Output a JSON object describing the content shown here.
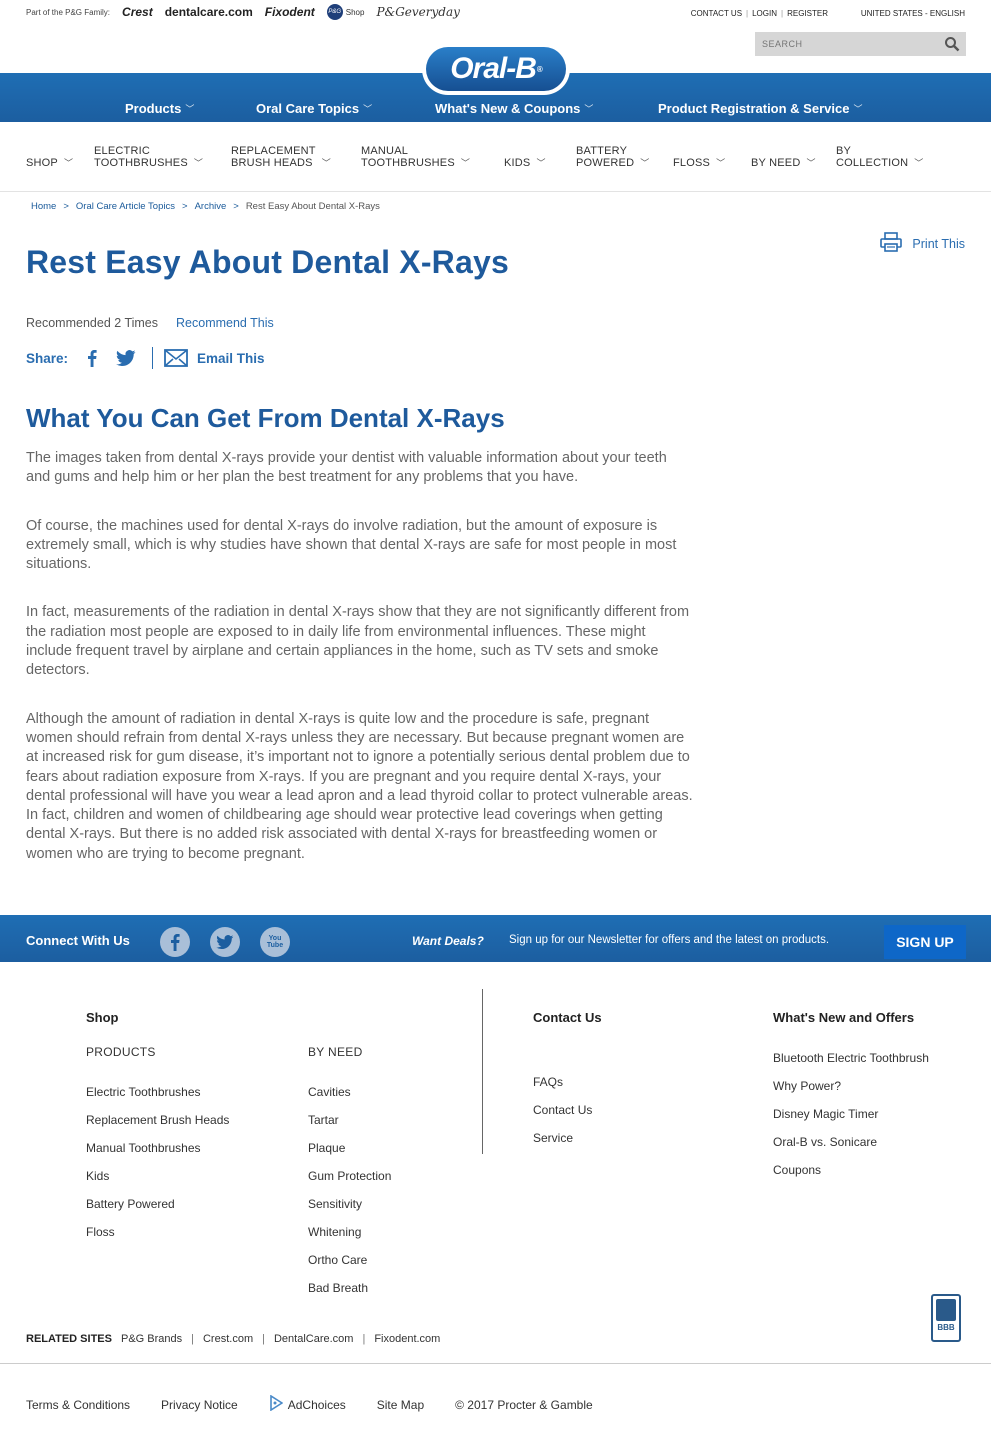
{
  "family": {
    "label": "Part of the P&G Family:",
    "brands": [
      "Crest",
      "dentalcare.com",
      "Fixodent",
      "Shop",
      "P&Geveryday"
    ],
    "pg_mark": "P&G"
  },
  "toplinks": {
    "contact": "CONTACT US",
    "login": "LOGIN",
    "register": "REGISTER",
    "region": "UNITED STATES - ENGLISH"
  },
  "search": {
    "placeholder": "SEARCH"
  },
  "logo": {
    "text": "Oral-B",
    "reg": "®"
  },
  "main_nav": [
    "Products",
    "Oral Care Topics",
    "What's New & Coupons",
    "Product Registration & Service"
  ],
  "sub_nav": [
    [
      "SHOP"
    ],
    [
      "ELECTRIC",
      "TOOTHBRUSHES"
    ],
    [
      "REPLACEMENT",
      "BRUSH HEADS"
    ],
    [
      "MANUAL",
      "TOOTHBRUSHES"
    ],
    [
      "KIDS"
    ],
    [
      "BATTERY",
      "POWERED"
    ],
    [
      "FLOSS"
    ],
    [
      "BY NEED"
    ],
    [
      "BY",
      "COLLECTION"
    ]
  ],
  "breadcrumb": [
    "Home",
    "Oral Care Article Topics",
    "Archive",
    "Rest Easy About Dental X-Rays"
  ],
  "print_label": "Print This",
  "title": "Rest Easy About Dental X-Rays",
  "recommend": {
    "count_text": "Recommended 2 Times",
    "link": "Recommend This"
  },
  "share": {
    "label": "Share:",
    "email": "Email This"
  },
  "subtitle": "What You Can Get From Dental X-Rays",
  "paragraphs": [
    "The images taken from dental X-rays provide your dentist with valuable information about your teeth and gums and help him or her plan the best treatment for any problems that you have.",
    "Of course, the machines used for dental X-rays do involve radiation, but the amount of exposure is extremely small, which is why studies have shown that dental X-rays are safe for most people in most situations.",
    "In fact, measurements of the radiation in dental X-rays show that they are not significantly different from the radiation most people are exposed to in daily life from environmental influences. These might include frequent travel by airplane and certain appliances in the home, such as TV sets and smoke detectors.",
    "Although the amount of radiation in dental X-rays is quite low and the procedure is safe, pregnant women should refrain from dental X-rays unless they are necessary. But because pregnant women are at increased risk for gum disease, it’s important not to ignore a potentially serious dental problem due to fears about radiation exposure from X-rays. If you are pregnant and you require dental X-rays, your dental professional will have you wear a lead apron and a lead thyroid collar to protect vulnerable areas. In fact, children and women of childbearing age should wear protective lead coverings when getting dental X-rays. But there is no added risk associated with dental X-rays for breastfeeding women or women who are trying to become pregnant."
  ],
  "connect": {
    "label": "Connect With Us",
    "youtube_text": "You Tube",
    "deals": "Want Deals?",
    "newsletter": "Sign up for our Newsletter for offers and the latest on products.",
    "signup": "SIGN UP"
  },
  "footer": {
    "shop_title": "Shop",
    "products_label": "PRODUCTS",
    "products": [
      "Electric Toothbrushes",
      "Replacement Brush Heads",
      "Manual Toothbrushes",
      "Kids",
      "Battery Powered",
      "Floss"
    ],
    "byneed_label": "BY NEED",
    "byneed": [
      "Cavities",
      "Tartar",
      "Plaque",
      "Gum Protection",
      "Sensitivity",
      "Whitening",
      "Ortho Care",
      "Bad Breath"
    ],
    "contact_title": "Contact Us",
    "contact": [
      "FAQs",
      "Contact Us",
      "Service"
    ],
    "news_title": "What's New and Offers",
    "news": [
      "Bluetooth Electric Toothbrush",
      "Why Power?",
      "Disney Magic Timer",
      "Oral-B vs. Sonicare",
      "Coupons"
    ]
  },
  "related": {
    "label": "RELATED SITES",
    "sites": [
      "P&G Brands",
      "Crest.com",
      "DentalCare.com",
      "Fixodent.com"
    ]
  },
  "bbb": "BBB",
  "legal": [
    "Terms & Conditions",
    "Privacy Notice",
    "AdChoices",
    "Site Map",
    "© 2017 Procter & Gamble"
  ],
  "colors": {
    "brand_blue": "#1e5a9c",
    "nav_blue": "#1f6eb4",
    "link_blue": "#2a6db0",
    "signup_blue": "#0e67c8"
  }
}
